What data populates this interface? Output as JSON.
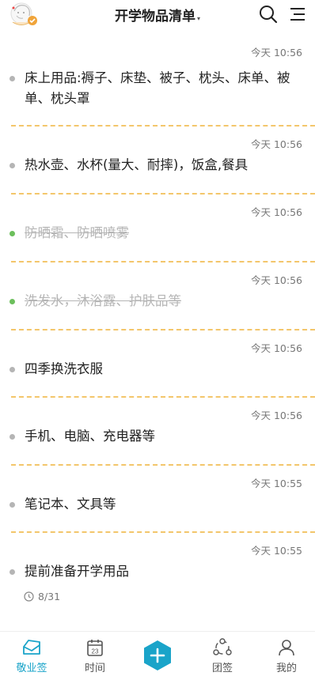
{
  "header": {
    "title": "开学物品清单",
    "caret": "▾"
  },
  "colors": {
    "accent": "#1aa4c9",
    "done_dot": "#6cbf5c",
    "separator": "#f3c66b"
  },
  "items": [
    {
      "time": "今天 10:56",
      "text": "床上用品:褥子、床垫、被子、枕头、床单、被单、枕头罩",
      "done": false
    },
    {
      "time": "今天 10:56",
      "text": "热水壶、水杯(量大、耐摔)，饭盒,餐具",
      "done": false
    },
    {
      "time": "今天 10:56",
      "text": "防晒霜、防晒喷雾",
      "done": true
    },
    {
      "time": "今天 10:56",
      "text": "洗发水，沐浴露、护肤品等",
      "done": true
    },
    {
      "time": "今天 10:56",
      "text": "四季换洗衣服",
      "done": false
    },
    {
      "time": "今天 10:56",
      "text": "手机、电脑、充电器等",
      "done": false
    },
    {
      "time": "今天 10:55",
      "text": "笔记本、文具等",
      "done": false
    },
    {
      "time": "今天 10:55",
      "text": "提前准备开学用品",
      "done": false,
      "reminder": "8/31"
    }
  ],
  "tabs": [
    {
      "label": "敬业签",
      "icon": "envelope-icon",
      "active": true
    },
    {
      "label": "时间",
      "icon": "calendar-icon",
      "calendar_day": "23",
      "active": false
    },
    {
      "label": "",
      "icon": "plus-hexagon-icon",
      "active": false
    },
    {
      "label": "团签",
      "icon": "team-icon",
      "active": false
    },
    {
      "label": "我的",
      "icon": "user-icon",
      "active": false
    }
  ]
}
